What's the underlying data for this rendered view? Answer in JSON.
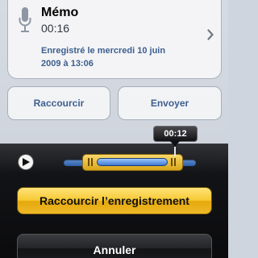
{
  "memo": {
    "title": "Mémo",
    "duration": "00:16",
    "recorded_line1": "Enregistré le mercredi 10 juin",
    "recorded_line2": "2009 à 13:06",
    "icon": "microphone-icon"
  },
  "actions": {
    "shorten_label": "Raccourcir",
    "send_label": "Envoyer"
  },
  "trim": {
    "time": "00:12",
    "play_icon": "play-icon",
    "selection_start_fraction": 0.14,
    "selection_end_fraction": 0.9,
    "playhead_fraction": 0.83
  },
  "buttons": {
    "trim_recording_label": "Raccourcir l’enregistrement",
    "cancel_label": "Annuler"
  },
  "colors": {
    "accent_blue": "#3d5f8f",
    "trim_yellow": "#f7c933",
    "sheet_black": "#121316"
  }
}
